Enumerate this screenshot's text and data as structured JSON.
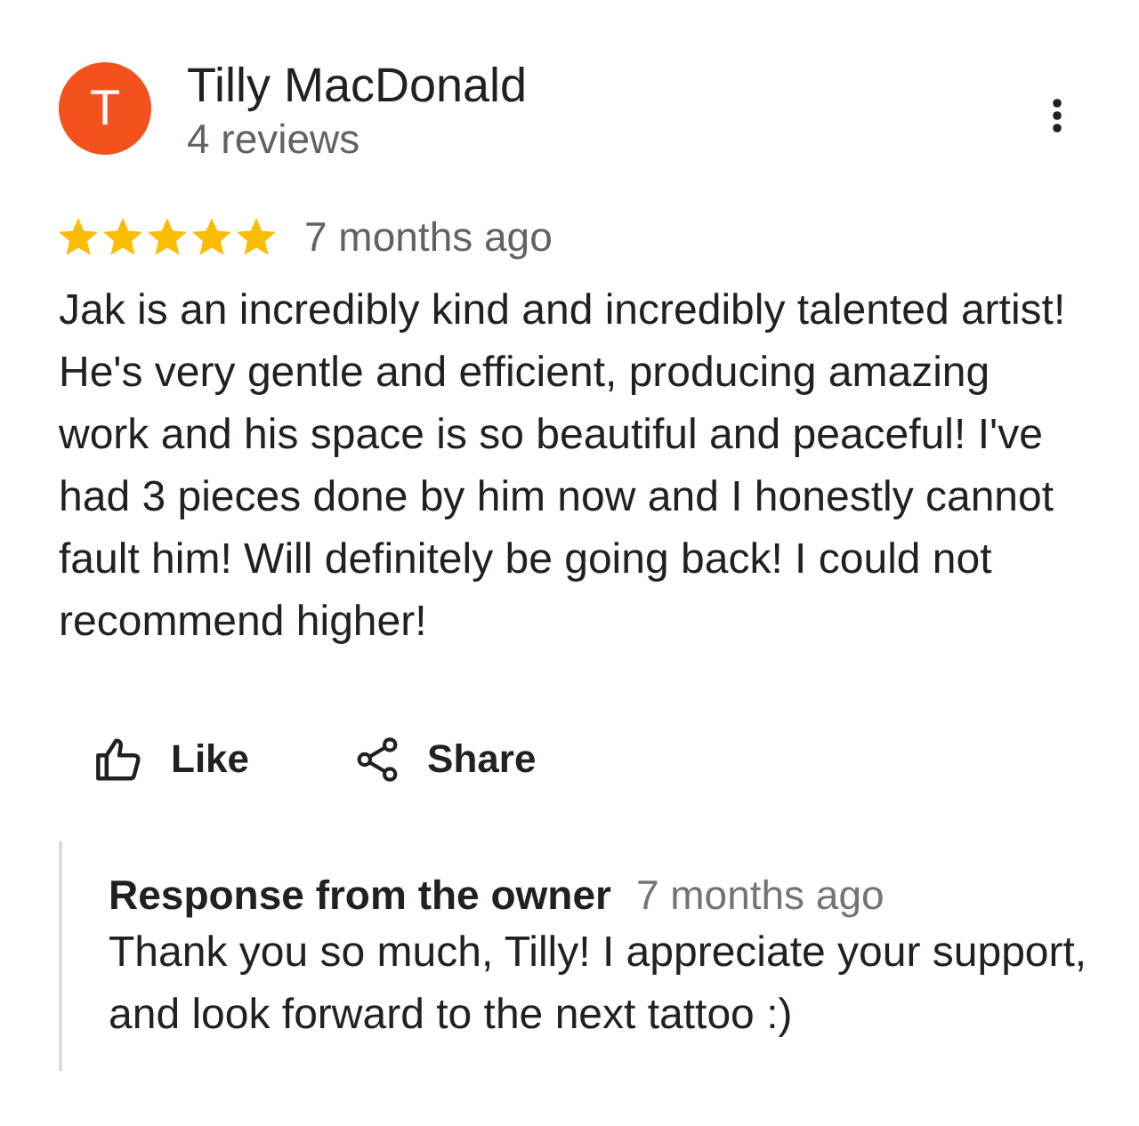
{
  "review": {
    "author": {
      "initial": "T",
      "name": "Tilly MacDonald",
      "review_count": "4 reviews"
    },
    "stars": 5,
    "time": "7 months ago",
    "text": "Jak is an incredibly kind and incredibly talented artist! He's very gentle and efficient, producing amazing work and his space is so beautiful and peaceful! I've had 3 pieces done by him now and I honestly cannot fault him! Will definitely be going back! I could not recommend higher!",
    "actions": [
      {
        "kind": "like",
        "label": "Like"
      },
      {
        "kind": "share",
        "label": "Share"
      }
    ]
  },
  "owner_response": {
    "title": "Response from the owner",
    "time": "7 months ago",
    "text": "Thank you so much, Tilly! I appreciate your support, and look forward to the next tattoo :)"
  }
}
